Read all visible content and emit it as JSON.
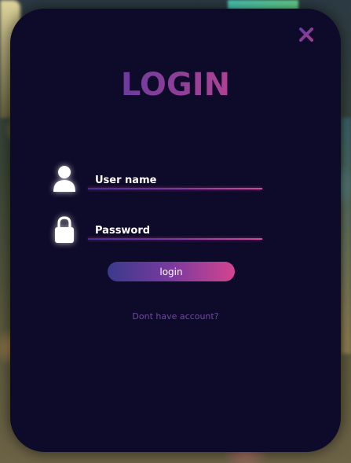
{
  "window": {
    "title": "LOGIN",
    "close_icon": "close-x-icon"
  },
  "form": {
    "username": {
      "icon": "user-icon",
      "placeholder": "User name",
      "value": ""
    },
    "password": {
      "icon": "lock-icon",
      "placeholder": "Password",
      "value": ""
    },
    "submit_label": "login",
    "signup_link": "Dont have account?"
  },
  "colors": {
    "panel_background": "#0e0a29",
    "accent_start": "#3b3a8c",
    "accent_mid": "#7a3a9e",
    "accent_end": "#d44490",
    "link": "#6d4a9e",
    "close_icon": "#7a3a9e"
  }
}
